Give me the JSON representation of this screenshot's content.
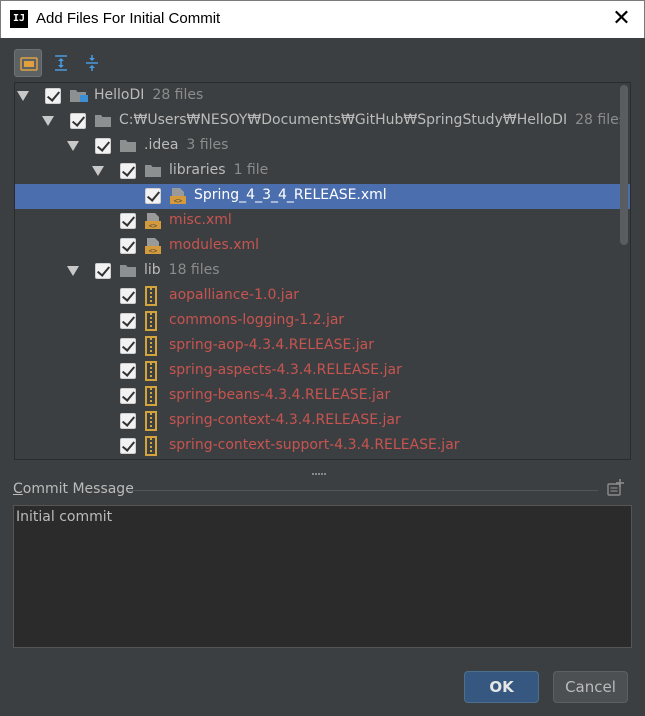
{
  "window": {
    "app_icon_text": "IJ",
    "title": "Add Files For Initial Commit",
    "close_glyph": "✕"
  },
  "toolbar": {
    "buttons": [
      {
        "icon": "group-by-directory-icon",
        "active": true
      },
      {
        "icon": "expand-all-icon",
        "active": false
      },
      {
        "icon": "collapse-all-icon",
        "active": false
      }
    ]
  },
  "tree": {
    "rows": [
      {
        "label": "HelloDI",
        "count": "28 files",
        "kind": "module",
        "expanded": true,
        "checked": true,
        "status": "normal"
      },
      {
        "label": "C:₩Users₩NESOY₩Documents₩GitHub₩SpringStudy₩HelloDI",
        "count": "28 files",
        "kind": "folder",
        "expanded": true,
        "checked": true,
        "status": "normal"
      },
      {
        "label": ".idea",
        "count": "3 files",
        "kind": "folder",
        "expanded": true,
        "checked": true,
        "status": "normal"
      },
      {
        "label": "libraries",
        "count": "1 file",
        "kind": "folder",
        "expanded": true,
        "checked": true,
        "status": "normal"
      },
      {
        "label": "Spring_4_3_4_RELEASE.xml",
        "count": "",
        "kind": "xml",
        "expanded": false,
        "checked": true,
        "status": "selected"
      },
      {
        "label": "misc.xml",
        "count": "",
        "kind": "xml",
        "expanded": false,
        "checked": true,
        "status": "unversioned"
      },
      {
        "label": "modules.xml",
        "count": "",
        "kind": "xml",
        "expanded": false,
        "checked": true,
        "status": "unversioned"
      },
      {
        "label": "lib",
        "count": "18 files",
        "kind": "folder",
        "expanded": true,
        "checked": true,
        "status": "normal"
      },
      {
        "label": "aopalliance-1.0.jar",
        "count": "",
        "kind": "jar",
        "expanded": false,
        "checked": true,
        "status": "unversioned"
      },
      {
        "label": "commons-logging-1.2.jar",
        "count": "",
        "kind": "jar",
        "expanded": false,
        "checked": true,
        "status": "unversioned"
      },
      {
        "label": "spring-aop-4.3.4.RELEASE.jar",
        "count": "",
        "kind": "jar",
        "expanded": false,
        "checked": true,
        "status": "unversioned"
      },
      {
        "label": "spring-aspects-4.3.4.RELEASE.jar",
        "count": "",
        "kind": "jar",
        "expanded": false,
        "checked": true,
        "status": "unversioned"
      },
      {
        "label": "spring-beans-4.3.4.RELEASE.jar",
        "count": "",
        "kind": "jar",
        "expanded": false,
        "checked": true,
        "status": "unversioned"
      },
      {
        "label": "spring-context-4.3.4.RELEASE.jar",
        "count": "",
        "kind": "jar",
        "expanded": false,
        "checked": true,
        "status": "unversioned"
      },
      {
        "label": "spring-context-support-4.3.4.RELEASE.jar",
        "count": "",
        "kind": "jar",
        "expanded": false,
        "checked": true,
        "status": "unversioned"
      }
    ]
  },
  "commit": {
    "label_mnemonic": "C",
    "label_rest": "ommit Message",
    "history_icon": "commit-history-icon",
    "message": "Initial commit"
  },
  "buttons": {
    "ok": "OK",
    "cancel": "Cancel"
  },
  "colors": {
    "background": "#3c3f41",
    "selection": "#4b6eaf",
    "unversioned_text": "#c75450",
    "text": "#bbbbbb",
    "ok_button": "#365880"
  }
}
